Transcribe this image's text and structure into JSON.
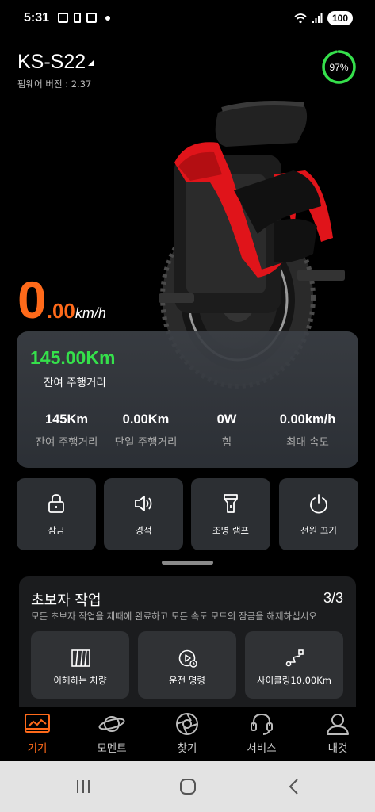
{
  "status_bar": {
    "time": "5:31",
    "battery": "100"
  },
  "device": {
    "name": "KS-S22",
    "firmware": "펌웨어 버전 : 2.37",
    "battery_percent": "97%",
    "battery_level": 0.97
  },
  "speed": {
    "integer": "0",
    "decimal": ".00",
    "unit": "km/h"
  },
  "stats": {
    "remaining_value": "145.00Km",
    "remaining_label": "잔여 주행거리",
    "items": [
      {
        "value": "145Km",
        "label": "잔여 주행거리"
      },
      {
        "value": "0.00Km",
        "label": "단일 주행거리"
      },
      {
        "value": "0W",
        "label": "힘"
      },
      {
        "value": "0.00km/h",
        "label": "최대 속도"
      }
    ]
  },
  "actions": [
    {
      "label": "잠금",
      "icon": "lock-icon"
    },
    {
      "label": "경적",
      "icon": "speaker-icon"
    },
    {
      "label": "조명 램프",
      "icon": "flashlight-icon"
    },
    {
      "label": "전원 끄기",
      "icon": "power-icon"
    }
  ],
  "tasks": {
    "title": "초보자 작업",
    "count": "3/3",
    "description": "모든 초보자 작업을 제때에 완료하고 모든 속도 모드의 잠금을 해제하십시오",
    "items": [
      {
        "label": "이해하는 차량",
        "icon": "vehicle-panel-icon"
      },
      {
        "label": "운전 명령",
        "icon": "play-clock-icon"
      },
      {
        "label": "사이클링10.00Km",
        "icon": "route-icon"
      }
    ]
  },
  "nav": {
    "items": [
      {
        "label": "기기",
        "icon": "device-icon",
        "active": true
      },
      {
        "label": "모멘트",
        "icon": "planet-icon",
        "active": false
      },
      {
        "label": "찾기",
        "icon": "aperture-icon",
        "active": false
      },
      {
        "label": "서비스",
        "icon": "headset-icon",
        "active": false
      },
      {
        "label": "내것",
        "icon": "user-icon",
        "active": false
      }
    ]
  },
  "colors": {
    "accent": "#ff6a1a",
    "green": "#35e04b",
    "card": "#2c2f33",
    "wheel_red": "#e0141a"
  }
}
